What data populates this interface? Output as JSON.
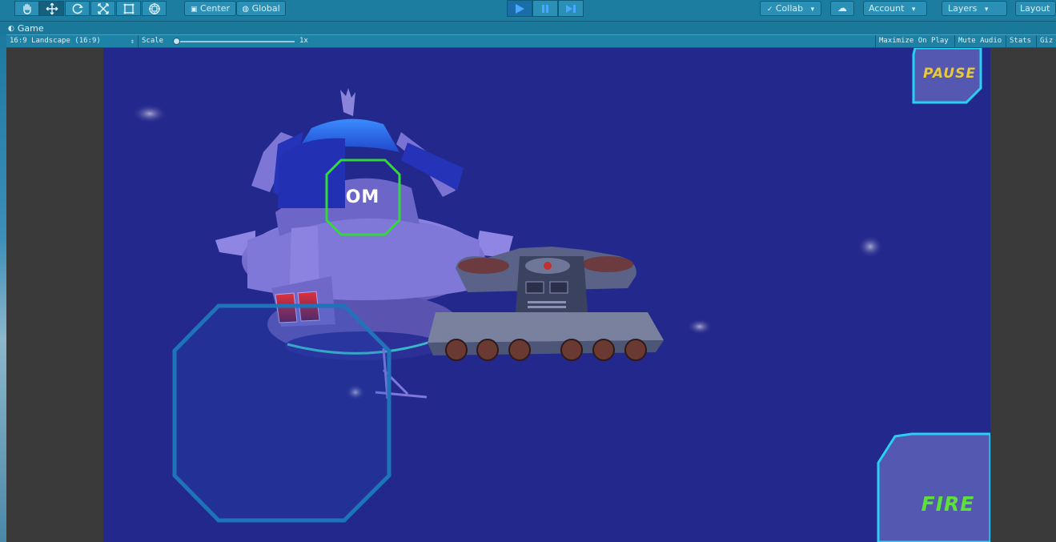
{
  "toolbar": {
    "pivot_label": "Center",
    "space_label": "Global",
    "collab_label": "Collab",
    "account_label": "Account",
    "layers_label": "Layers",
    "layout_label": "Layout",
    "tools": [
      "hand-tool-icon",
      "move-tool-icon",
      "rotate-tool-icon",
      "scale-tool-icon",
      "rect-tool-icon",
      "transform-tool-icon"
    ],
    "active_tool": "move-tool-icon",
    "play_state": "playing"
  },
  "game_tab": {
    "title": "Game",
    "aspect": "16:9 Landscape (16:9)",
    "scale_label": "Scale",
    "scale_value": "1x",
    "scale_fraction": 0,
    "maximize_on_play": "Maximize On Play",
    "mute_audio": "Mute Audio",
    "stats": "Stats",
    "gizmos": "Giz"
  },
  "hud": {
    "pause_label": "PAUSE",
    "fire_label": "FIRE",
    "target_label": "OM",
    "pause_color": "#e8c93a",
    "fire_color": "#5ee03a",
    "target_ring_color": "#35d83a",
    "button_border_color": "#28d1f2"
  },
  "colors": {
    "toolbar_bg": "#1c7da1",
    "viewport_bg": "#23288c",
    "joystick": "#1f73b8"
  }
}
